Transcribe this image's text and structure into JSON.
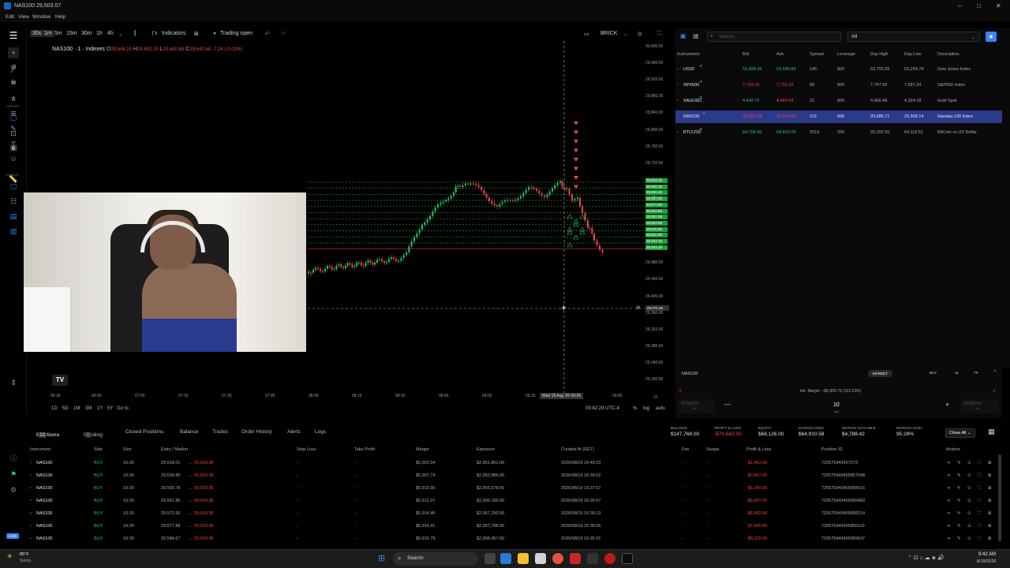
{
  "window": {
    "title": "NAS100 29,503.07",
    "controls": [
      "–",
      "□",
      "✕"
    ]
  },
  "menu": [
    "Edit",
    "View",
    "Window",
    "Help"
  ],
  "toolbar": {
    "intervals": [
      "30s",
      "1m",
      "5m",
      "15m",
      "30m",
      "1h",
      "4h"
    ],
    "active_interval": "1m",
    "indicators": "Indicators",
    "trading": "Trading open",
    "brick": "BRICK"
  },
  "left_sections": {
    "spaces": "SPACES",
    "panels": "PANELS"
  },
  "chart": {
    "symbol": "NAS100 · 1 · Indexes",
    "ohlc": {
      "o_label": "O",
      "o": "29,648.25",
      "h_label": "H",
      "h": "29,652.25",
      "l_label": "L",
      "l": "29,640.68",
      "c_label": "C",
      "c": "29,640.68",
      "chg": "-7.24 (-0.02%)"
    },
    "y_ticks": [
      "30,000.00",
      "29,960.00",
      "29,920.00",
      "29,880.00",
      "29,840.00",
      "29,800.00",
      "29,760.00",
      "29,720.00",
      "29,680.00",
      "29,640.00",
      "29,600.00",
      "29,560.00",
      "29,520.00",
      "29,480.00",
      "29,440.00",
      "29,400.00",
      "29,360.00",
      "29,320.00",
      "29,280.00",
      "29,240.00",
      "29,200.00"
    ],
    "price_labels": [
      "29,623.45",
      "29,602.39",
      "29,596.48",
      "29,587.80",
      "29,577.90",
      "29,569.85",
      "29,561.85",
      "29,553.88",
      "29,539.88",
      "29,522.88",
      "29,504.33",
      "29,503.38"
    ],
    "cursor_price": "29,372.45",
    "x_ticks": [
      "06:30",
      "06:45",
      "07:00",
      "07:15",
      "07:30",
      "07:45",
      "08:00",
      "08:15",
      "08:30",
      "08:45",
      "09:00",
      "09:15",
      "09:28",
      "09:45"
    ],
    "cursor_time": "Wed 19 Aug '26",
    "ranges": [
      "1D",
      "5D",
      "1M",
      "3M",
      "1Y",
      "5Y"
    ],
    "goto": "Go to",
    "clock": "09:42:29 UTC-4",
    "pct": "%",
    "log": "log",
    "auto": "auto"
  },
  "instruments": {
    "filter": "All",
    "search_placeholder": "Search...",
    "headers": [
      "Instruments",
      "Bid",
      "Ask",
      "Spread",
      "Leverage",
      "Day High",
      "Day Low",
      "Description"
    ],
    "rows": [
      {
        "name": "US30",
        "bid": "53,484.39",
        "ask": "53,485.84",
        "spread": "145",
        "lev": "500",
        "high": "53,700.25",
        "low": "53,294.74",
        "desc": "Dow Jones Index",
        "bidc": "green",
        "askc": "green"
      },
      {
        "name": "SPX500",
        "bid": "7,724.20",
        "ask": "7,725.19",
        "spread": "99",
        "lev": "500",
        "high": "7,747.95",
        "low": "7,687.24",
        "desc": "S&P500 Index",
        "bidc": "red",
        "askc": "red"
      },
      {
        "name": "XAUUSD",
        "bid": "4,449.72",
        "ask": "4,449.94",
        "spread": "22",
        "lev": "500",
        "high": "4,466.49",
        "low": "4,324.18",
        "desc": "Gold Spot",
        "bidc": "green",
        "askc": "red"
      },
      {
        "name": "NAS100",
        "bid": "29,503.38",
        "ask": "29,504.53",
        "spread": "115",
        "lev": "500",
        "high": "29,685.71",
        "low": "29,358.14",
        "desc": "Nasdaq-100 Index",
        "bidc": "red",
        "askc": "red"
      },
      {
        "name": "BTCUSD",
        "bid": "64,794.90",
        "ask": "64,820.09",
        "spread": "2519",
        "lev": "200",
        "high": "65,202.50",
        "low": "64,118.51",
        "desc": "BitCoin vs US Dollar",
        "bidc": "green",
        "askc": "green"
      }
    ]
  },
  "order": {
    "symbol": "NAS100",
    "market": "MARKET",
    "buy": "BUY",
    "sl": "SL",
    "tp": "TP",
    "init_margin": "Init. Margin: ~$5,900.79 (123.23%)",
    "sell_price": "29,503.38",
    "buy_price": "29,504.53",
    "qty": "10",
    "lots": "lots",
    "bid_lbl": "Bid",
    "ask_lbl": "Ask"
  },
  "tabs": [
    {
      "label": "Positions",
      "count": "33"
    },
    {
      "label": "Pending",
      "count": "0"
    },
    {
      "label": "Closed Positions"
    },
    {
      "label": "Balance"
    },
    {
      "label": "Trades"
    },
    {
      "label": "Order History"
    },
    {
      "label": "Alerts"
    },
    {
      "label": "Logs"
    }
  ],
  "summary": {
    "balance_lbl": "BALANCE",
    "balance": "$147,768.00",
    "pnl_lbl": "PROFIT & LOSS",
    "pnl": "-$79,642.00",
    "equity_lbl": "EQUITY",
    "equity": "$68,126.00",
    "mused_lbl": "MARGIN USED",
    "mused": "$64,910.58",
    "mavail_lbl": "MARGIN AVAILABLE",
    "mavail": "$4,788.42",
    "mlevel_lbl": "MARGIN LEVEL",
    "mlevel": "95.28%",
    "close_all": "Close All"
  },
  "positions": {
    "headers": [
      "Instrument",
      "Side",
      "Size",
      "Entry / Market",
      "Stop Loss",
      "Take Profit",
      "Margin",
      "Exposure",
      "Created At (EET)",
      "Fee",
      "Swaps",
      "Profit & Loss",
      "Position ID",
      "Actions"
    ],
    "rows": [
      {
        "inst": "NAS100",
        "side": "BUY",
        "size": "10.00",
        "entry": "29,518.01",
        "market": "29,503.38",
        "sl": "-",
        "tp": "-",
        "margin": "$5,903.54",
        "exp": "$2,951,801.00",
        "created": "2026/08/19 16:40:23",
        "fee": "-",
        "swap": "-",
        "pnl": "-$1,463.00",
        "id": "720575940457573"
      },
      {
        "inst": "NAS100",
        "side": "BUY",
        "size": "10.00",
        "entry": "29,539.85",
        "market": "29,503.38",
        "sl": "-",
        "tp": "-",
        "margin": "$5,907.74",
        "exp": "$2,953,985.00",
        "created": "2026/08/19 16:39:02",
        "fee": "-",
        "swap": "-",
        "pnl": "-$3,647.00",
        "id": "720575940455857048"
      },
      {
        "inst": "NAS100",
        "side": "BUY",
        "size": "10.00",
        "entry": "29,555.78",
        "market": "29,503.38",
        "sl": "-",
        "tp": "-",
        "margin": "$5,910.95",
        "exp": "$2,955,578.00",
        "created": "2026/08/19 16:37:57",
        "fee": "-",
        "swap": "-",
        "pnl": "-$5,240.00",
        "id": "720575940455858616"
      },
      {
        "inst": "NAS100",
        "side": "BUY",
        "size": "10.00",
        "entry": "29,561.85",
        "market": "29,503.38",
        "sl": "-",
        "tp": "-",
        "margin": "$5,912.07",
        "exp": "$2,956,185.00",
        "created": "2026/08/19 16:36:57",
        "fee": "-",
        "swap": "-",
        "pnl": "-$5,847.00",
        "id": "720575940455856483"
      },
      {
        "inst": "NAS100",
        "side": "BUY",
        "size": "10.00",
        "entry": "29,572.90",
        "market": "29,503.38",
        "sl": "-",
        "tp": "-",
        "margin": "$5,914.46",
        "exp": "$2,957,290.00",
        "created": "2026/08/19 16:36:13",
        "fee": "-",
        "swap": "-",
        "pnl": "-$6,952.00",
        "id": "720575940455858214"
      },
      {
        "inst": "NAS100",
        "side": "BUY",
        "size": "10.00",
        "entry": "29,577.88",
        "market": "29,503.38",
        "sl": "-",
        "tp": "-",
        "margin": "$5,915.41",
        "exp": "$2,957,788.00",
        "created": "2026/08/19 16:36:05",
        "fee": "-",
        "swap": "-",
        "pnl": "-$7,430.00",
        "id": "720575940455850119"
      },
      {
        "inst": "NAS100",
        "side": "BUY",
        "size": "10.00",
        "entry": "29,584.67",
        "market": "29,503.38",
        "sl": "-",
        "tp": "-",
        "margin": "$5,916.79",
        "exp": "$2,958,467.00",
        "created": "2026/08/19 16:35:31",
        "fee": "-",
        "swap": "-",
        "pnl": "-$8,129.00",
        "id": "720575940455859637"
      }
    ]
  },
  "taskbar": {
    "weather": "85°F",
    "weather_desc": "Sunny",
    "search": "Search",
    "time": "9:42 AM",
    "date": "8/19/2026",
    "live": "LIVE"
  },
  "colors": {
    "accent": "#3b82f6",
    "up": "#22c55e",
    "down": "#ef4444",
    "selected_row": "#2c3a8c"
  }
}
